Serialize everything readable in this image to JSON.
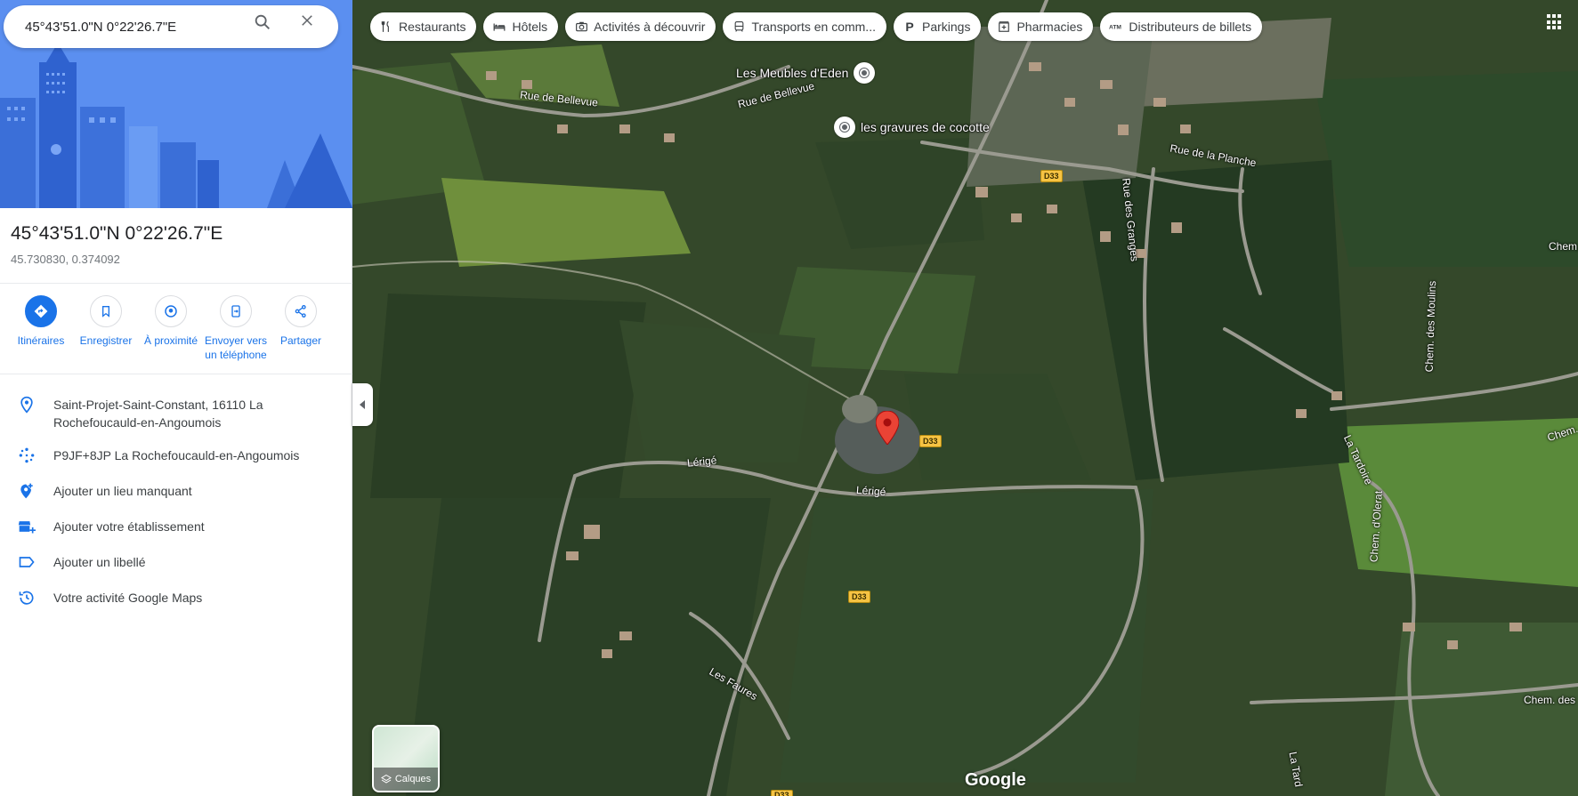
{
  "search": {
    "value": "45°43'51.0\"N 0°22'26.7\"E"
  },
  "place": {
    "title": "45°43'51.0\"N 0°22'26.7\"E",
    "coords": "45.730830, 0.374092"
  },
  "actions": [
    {
      "label": "Itinéraires",
      "icon": "directions-icon"
    },
    {
      "label": "Enregistrer",
      "icon": "bookmark-icon"
    },
    {
      "label": "À proximité",
      "icon": "nearby-icon"
    },
    {
      "label": "Envoyer vers un téléphone",
      "icon": "send-to-phone-icon"
    },
    {
      "label": "Partager",
      "icon": "share-icon"
    }
  ],
  "info": {
    "address": "Saint-Projet-Saint-Constant, 16110 La Rochefoucauld-en-Angoumois",
    "pluscode": "P9JF+8JP La Rochefoucauld-en-Angoumois",
    "add_place": "Ajouter un lieu manquant",
    "add_business": "Ajouter votre établissement",
    "add_label": "Ajouter un libellé",
    "activity": "Votre activité Google Maps"
  },
  "chips": [
    {
      "label": "Restaurants",
      "icon": "restaurant-icon"
    },
    {
      "label": "Hôtels",
      "icon": "hotel-icon"
    },
    {
      "label": "Activités à découvrir",
      "icon": "camera-icon"
    },
    {
      "label": "Transports en comm...",
      "icon": "transit-icon"
    },
    {
      "label": "Parkings",
      "icon": "parking-icon"
    },
    {
      "label": "Pharmacies",
      "icon": "pharmacy-icon"
    },
    {
      "label": "Distributeurs de billets",
      "icon": "atm-icon"
    }
  ],
  "map": {
    "pois": [
      "Les Meubles d'Eden",
      "les gravures de cocotte"
    ],
    "roads": {
      "bellevue_1": "Rue de Bellevue",
      "bellevue_2": "Rue de Bellevue",
      "planche": "Rue de la Planche",
      "granges": "Rue des Granges",
      "lerige_1": "Lérigé",
      "lerige_2": "Lérigé",
      "faures": "Les Faures",
      "tardoire_1": "La Tardoire",
      "tardoire_2": "La Tard",
      "moulins": "Chem. des Moulins",
      "olerat": "Chem. d'Olerat",
      "chem_top": "Chem.",
      "chem_mid": "Chem.",
      "chem_des": "Chem. des",
      "d33": "D33"
    },
    "layers_label": "Calques",
    "logo": "Google"
  },
  "colors": {
    "accent": "#1a73e8",
    "pin": "#ea4335",
    "shield": "#f6c343"
  }
}
